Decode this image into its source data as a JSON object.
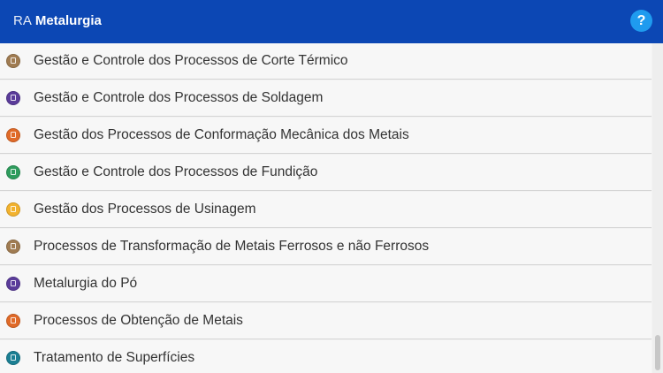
{
  "header": {
    "prefix": "RA",
    "title": "Metalurgia",
    "help_label": "?"
  },
  "colors": {
    "app_bar": "#0c47b4",
    "help_button": "#1f9bef"
  },
  "list": {
    "items": [
      {
        "label": "Gestão e Controle dos Processos de Corte Térmico",
        "icon": "brown-gear-icon",
        "color": "#a07c52"
      },
      {
        "label": "Gestão e Controle dos Processos de Soldagem",
        "icon": "purple-welding-icon",
        "color": "#5b3c9a"
      },
      {
        "label": "Gestão dos Processos de Conformação Mecânica dos Metais",
        "icon": "orange-press-icon",
        "color": "#e06a28"
      },
      {
        "label": "Gestão e Controle dos Processos de Fundição",
        "icon": "green-casting-icon",
        "color": "#2e9c5d"
      },
      {
        "label": "Gestão dos Processos de Usinagem",
        "icon": "yellow-machining-icon",
        "color": "#f2b22e"
      },
      {
        "label": "Processos de Transformação de Metais Ferrosos e não Ferrosos",
        "icon": "brown-gear-icon",
        "color": "#a07c52"
      },
      {
        "label": "Metalurgia do Pó",
        "icon": "purple-welding-icon",
        "color": "#5b3c9a"
      },
      {
        "label": "Processos de Obtenção de Metais",
        "icon": "orange-press-icon",
        "color": "#e06a28"
      },
      {
        "label": "Tratamento de Superfícies",
        "icon": "teal-surface-icon",
        "color": "#1b7f93"
      }
    ]
  }
}
